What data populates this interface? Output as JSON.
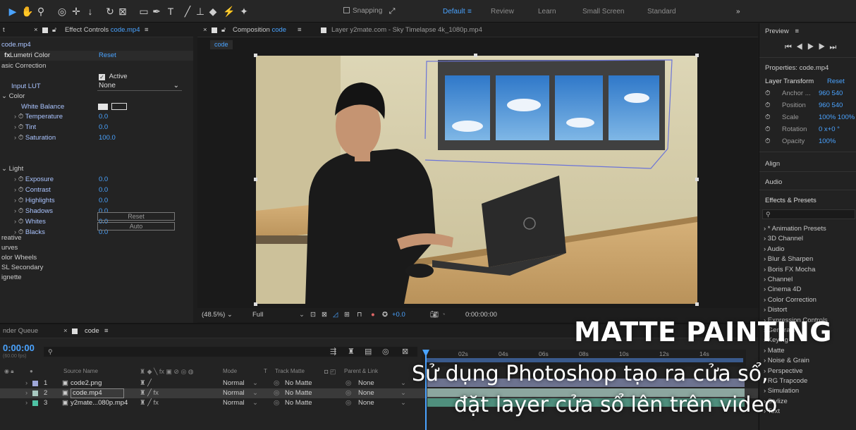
{
  "toolbar": {
    "snapping_label": "Snapping",
    "workspaces": [
      "Default",
      "Review",
      "Learn",
      "Small Screen",
      "Standard"
    ],
    "overflow": "»"
  },
  "effect_controls": {
    "tab_close": "×",
    "title": "Effect Controls",
    "file": "code.mp4",
    "layer_label": "code.mp4",
    "effect_name": "Lumetri Color",
    "reset": "Reset",
    "basic_correction": "asic Correction",
    "active_label": "Active",
    "input_lut_label": "Input LUT",
    "input_lut_value": "None",
    "color_group": "Color",
    "white_balance": "White Balance",
    "params_color": [
      {
        "label": "Temperature",
        "value": "0.0"
      },
      {
        "label": "Tint",
        "value": "0.0"
      },
      {
        "label": "Saturation",
        "value": "100.0"
      }
    ],
    "light_group": "Light",
    "params_light": [
      {
        "label": "Exposure",
        "value": "0.0"
      },
      {
        "label": "Contrast",
        "value": "0.0"
      },
      {
        "label": "Highlights",
        "value": "0.0"
      },
      {
        "label": "Shadows",
        "value": "0.0"
      },
      {
        "label": "Whites",
        "value": "0.0"
      },
      {
        "label": "Blacks",
        "value": "0.0"
      }
    ],
    "reset_button": "Reset",
    "auto_button": "Auto",
    "sections": [
      "reative",
      "urves",
      "olor Wheels",
      "SL Secondary",
      "ignette"
    ]
  },
  "composition": {
    "title": "Composition",
    "name": "code",
    "layer_tab": "Layer  y2mate.com - Sky Timelapse 4k_1080p.mp4",
    "comp_tab": "code",
    "zoom": "(48.5%)",
    "quality": "Full",
    "exposure": "+0.0",
    "timecode": "0:00:00:00"
  },
  "right_panel": {
    "preview": "Preview",
    "properties_title": "Properties: code.mp4",
    "layer_transform": "Layer Transform",
    "reset": "Reset",
    "props": [
      {
        "label": "Anchor ...",
        "value": "960  540"
      },
      {
        "label": "Position",
        "value": "960  540"
      },
      {
        "label": "Scale",
        "value": "100%  100%"
      },
      {
        "label": "Rotation",
        "value": "0 x+0 °"
      },
      {
        "label": "Opacity",
        "value": "100%"
      }
    ],
    "align": "Align",
    "audio": "Audio",
    "effects_presets": "Effects & Presets",
    "fx_list": [
      "* Animation Presets",
      "3D Channel",
      "Audio",
      "Blur & Sharpen",
      "Boris FX Mocha",
      "Channel",
      "Cinema 4D",
      "Color Correction",
      "Distort",
      "Expression Controls",
      "Generate",
      "Keying",
      "Matte",
      "Noise & Grain",
      "Perspective",
      "RG Trapcode",
      "Simulation",
      "Stylize",
      "Text"
    ]
  },
  "timeline": {
    "render_queue": "nder Queue",
    "tab_name": "code",
    "timecode": "0:00:00",
    "fps": "(60.00 fps)",
    "col_source": "Source Name",
    "col_mode": "Mode",
    "col_t": "T",
    "col_trackmatte": "Track Matte",
    "col_parent": "Parent & Link",
    "ruler": [
      "02s",
      "04s",
      "06s",
      "08s",
      "10s",
      "12s",
      "14s"
    ],
    "layers": [
      {
        "num": "1",
        "name": "code2.png",
        "mode": "Normal",
        "matte": "No Matte",
        "parent": "None",
        "color": "#9fa7d9"
      },
      {
        "num": "2",
        "name": "code.mp4",
        "mode": "Normal",
        "matte": "No Matte",
        "parent": "None",
        "color": "#a9c9c1"
      },
      {
        "num": "3",
        "name": "y2mate...080p.mp4",
        "mode": "Normal",
        "matte": "No Matte",
        "parent": "None",
        "color": "#4ec2a4"
      }
    ]
  },
  "overlay": {
    "title": "MATTE PAINTING",
    "line1": "Sử dụng Photoshop tạo ra cửa sổ,",
    "line2": "đặt layer cửa sổ lên trên video"
  }
}
